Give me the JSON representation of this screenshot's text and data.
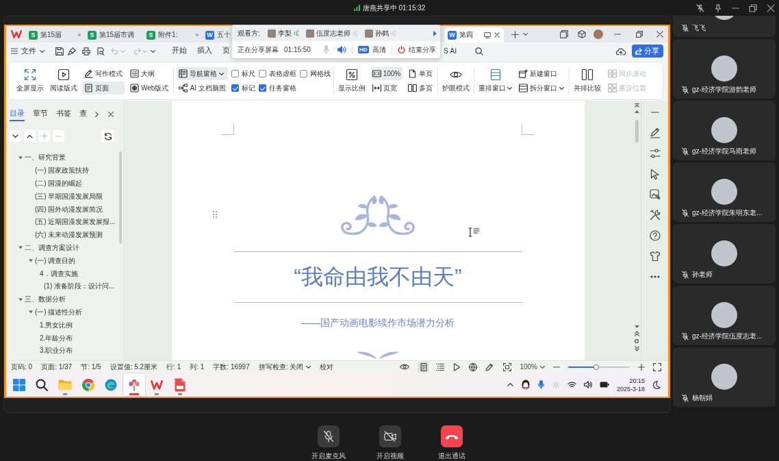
{
  "banner": {
    "text": "唐燕共享中 01:15:32"
  },
  "window_tabs": [
    {
      "kind": "sheet",
      "badge": "S",
      "label": "第15届",
      "selected": false,
      "unsaved": true,
      "shared": false
    },
    {
      "kind": "sheet",
      "badge": "S",
      "label": "第15届市调",
      "selected": false,
      "unsaved": false,
      "shared": false
    },
    {
      "kind": "sheet",
      "badge": "S",
      "label": "附件1:",
      "selected": false,
      "unsaved": true,
      "shared": false
    },
    {
      "kind": "doc",
      "badge": "W",
      "label": "五十",
      "selected": false,
      "unsaved": false,
      "shared": false
    },
    {
      "kind": "doc",
      "badge": "W",
      "label": "第四",
      "selected": true,
      "unsaved": false,
      "shared": true
    }
  ],
  "menu": {
    "file": "文件",
    "tabs": [
      {
        "label": "开始",
        "selected": false
      },
      {
        "label": "插入",
        "selected": false
      },
      {
        "label": "页",
        "selected": false
      },
      {
        "label": "S AI",
        "selected": false
      }
    ],
    "share_button": "分享"
  },
  "share_popup": {
    "viewers_label": "观看方:",
    "viewers": [
      {
        "name": "李梨",
        "speaking": true
      },
      {
        "name": "伍度志老师",
        "speaking": false
      },
      {
        "name": "孙鹤",
        "speaking": false
      }
    ],
    "status": "正在分享屏幕",
    "timer": "01:15:50",
    "mic_on": false,
    "speaker_on": true,
    "quality_badge": "HD",
    "quality": "高清",
    "end_button": "结束分享"
  },
  "ribbon": {
    "groups": [
      {
        "columns": [
          {
            "items": [
              {
                "kind": "large",
                "label": "全屏显示",
                "selected": false,
                "disabled": false
              }
            ]
          },
          {
            "items": [
              {
                "kind": "large",
                "label": "阅读版式",
                "selected": false,
                "disabled": false
              }
            ]
          },
          {
            "items": [
              {
                "kind": "small",
                "label": "写作模式",
                "selected": false,
                "disabled": false
              },
              {
                "kind": "small",
                "label": "页面",
                "selected": true,
                "disabled": false
              }
            ]
          },
          {
            "items": [
              {
                "kind": "small",
                "label": "大纲",
                "selected": false,
                "disabled": false
              },
              {
                "kind": "small",
                "label": "Web版式",
                "selected": false,
                "disabled": false
              }
            ]
          }
        ]
      },
      {
        "columns": [
          {
            "items": [
              {
                "kind": "small",
                "label": "导航窗格",
                "selected": true,
                "disabled": false,
                "dropdown": true
              },
              {
                "kind": "small",
                "label": "AI 文档脑图",
                "selected": false,
                "disabled": false
              }
            ]
          },
          {
            "items": [
              {
                "kind": "check",
                "label": "标尺",
                "checked": false
              },
              {
                "kind": "check",
                "label": "标记",
                "checked": true
              }
            ]
          },
          {
            "items": [
              {
                "kind": "check",
                "label": "表格虚框",
                "checked": false
              },
              {
                "kind": "check",
                "label": "任务窗格",
                "checked": true
              }
            ]
          },
          {
            "items": [
              {
                "kind": "check",
                "label": "网格线",
                "checked": false
              }
            ]
          }
        ]
      },
      {
        "columns": [
          {
            "items": [
              {
                "kind": "large",
                "label": "显示比例",
                "selected": false,
                "disabled": false
              }
            ]
          },
          {
            "items": [
              {
                "kind": "small",
                "label": "100%",
                "selected": true,
                "disabled": false
              },
              {
                "kind": "small",
                "label": "页宽",
                "selected": false,
                "disabled": false
              }
            ]
          },
          {
            "items": [
              {
                "kind": "small",
                "label": "单页",
                "selected": false,
                "disabled": false
              },
              {
                "kind": "small",
                "label": "多页",
                "selected": false,
                "disabled": false
              }
            ]
          }
        ]
      },
      {
        "columns": [
          {
            "items": [
              {
                "kind": "large",
                "label": "护眼模式",
                "selected": false,
                "disabled": false
              }
            ]
          }
        ]
      },
      {
        "columns": [
          {
            "items": [
              {
                "kind": "large",
                "label": "重排窗口",
                "selected": false,
                "disabled": false,
                "dropdown": true
              }
            ]
          },
          {
            "items": [
              {
                "kind": "small",
                "label": "新建窗口",
                "selected": false,
                "disabled": false
              },
              {
                "kind": "small",
                "label": "拆分窗口",
                "selected": false,
                "disabled": false,
                "dropdown": true
              }
            ]
          }
        ]
      },
      {
        "columns": [
          {
            "items": [
              {
                "kind": "large",
                "label": "并排比较",
                "selected": false,
                "disabled": false
              }
            ]
          },
          {
            "items": [
              {
                "kind": "small",
                "label": "同步滚动",
                "selected": false,
                "disabled": true
              },
              {
                "kind": "small",
                "label": "重设位置",
                "selected": false,
                "disabled": true
              }
            ]
          }
        ]
      }
    ]
  },
  "nav_panel": {
    "tabs": [
      {
        "label": "目录",
        "selected": true
      },
      {
        "label": "章节",
        "selected": false
      },
      {
        "label": "书签",
        "selected": false
      },
      {
        "label": "查",
        "selected": false
      }
    ],
    "tool_buttons": [
      {
        "disabled": false
      },
      {
        "disabled": false
      },
      {
        "disabled": true
      },
      {
        "disabled": true
      },
      {
        "disabled": false
      }
    ],
    "outline": [
      {
        "label": "一、研究背景",
        "expanded": true,
        "children": [
          {
            "label": "(一) 国家政策扶持"
          },
          {
            "label": "(二) 国漫的崛起"
          },
          {
            "label": "(三) 早期国漫发展局限"
          },
          {
            "label": "(四) 国外动漫发展简况"
          },
          {
            "label": "(五) 近期国漫发展发展报..."
          },
          {
            "label": "(六) 未来动漫发展预测"
          }
        ]
      },
      {
        "label": "二、调查方案设计",
        "expanded": true,
        "children": [
          {
            "label": "(一) 调查目的",
            "expanded": true,
            "children": [
              {
                "label": "4．调查实施",
                "children": [
                  {
                    "label": "(1) 准备阶段：设计问..."
                  }
                ]
              }
            ]
          }
        ]
      },
      {
        "label": "三、数据分析",
        "expanded": true,
        "children": [
          {
            "label": "(一) 描述性分析",
            "expanded": true,
            "children": [
              {
                "label": "1.男女比例"
              },
              {
                "label": "2.年龄分布"
              },
              {
                "label": "3.职业分布"
              }
            ]
          }
        ]
      }
    ]
  },
  "document": {
    "title": "“我命由我不由天”",
    "subtitle": "——国产动画电影续作市场潜力分析"
  },
  "status_bar": {
    "fields": [
      "页码: 0",
      "页面: 1/37",
      "节: 1/5",
      "设置值: 5.2厘米",
      "行: 1",
      "列: 1",
      "字数: 16997"
    ],
    "spell_check": "拼写检查: 关闭",
    "proofread": "校对",
    "views": [
      {
        "selected": true
      },
      {
        "selected": false
      },
      {
        "selected": false
      },
      {
        "selected": false
      },
      {
        "selected": false
      }
    ],
    "zoom": "100%",
    "zoom_slider": {
      "level": 0.45
    }
  },
  "taskbar": {
    "apps": [
      {
        "running": true,
        "active": false
      },
      {
        "running": false,
        "active": false
      },
      {
        "running": false,
        "active": false
      },
      {
        "running": true,
        "active": true
      },
      {
        "running": true,
        "active": false
      },
      {
        "running": true,
        "active": false
      }
    ],
    "time": "20:15",
    "date": "2025-3-18"
  },
  "participants": [
    {
      "name": "飞飞",
      "muted": true
    },
    {
      "name": "gz-经济学院游韵老师",
      "muted": true
    },
    {
      "name": "gz-经济学院马雨老师",
      "muted": true
    },
    {
      "name": "gz-经济学院朱明东老...",
      "muted": true
    },
    {
      "name": "孙老师",
      "muted": true
    },
    {
      "name": "gz-经济学院伍度志老...",
      "muted": true
    },
    {
      "name": "杨朝娟",
      "muted": true
    }
  ],
  "call_controls": [
    {
      "kind": "mic",
      "label": "开启麦克风"
    },
    {
      "kind": "camera",
      "label": "开启视频"
    },
    {
      "kind": "hangup",
      "label": "退出通话"
    }
  ]
}
